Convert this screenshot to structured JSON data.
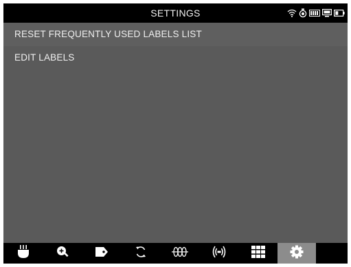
{
  "header": {
    "title": "SETTINGS",
    "status_icons": [
      "wifi-icon",
      "camera-icon",
      "signal-bars-icon",
      "monitor-icon",
      "battery-icon"
    ]
  },
  "menu": {
    "items": [
      {
        "label": "RESET FREQUENTLY USED LABELS LIST"
      },
      {
        "label": "EDIT LABELS"
      }
    ]
  },
  "toolbar": {
    "tools": [
      {
        "icon": "probe-icon"
      },
      {
        "icon": "zoom-in-icon"
      },
      {
        "icon": "label-tag-icon"
      },
      {
        "icon": "refresh-icon"
      },
      {
        "icon": "waveform-icon"
      },
      {
        "icon": "transmit-icon"
      },
      {
        "icon": "grid-icon"
      },
      {
        "icon": "gear-icon",
        "active": true
      }
    ]
  },
  "colors": {
    "background": "#5a5a5a",
    "bars": "#000000",
    "active_tool": "#8c8c8c",
    "text": "#f0f0f0"
  }
}
